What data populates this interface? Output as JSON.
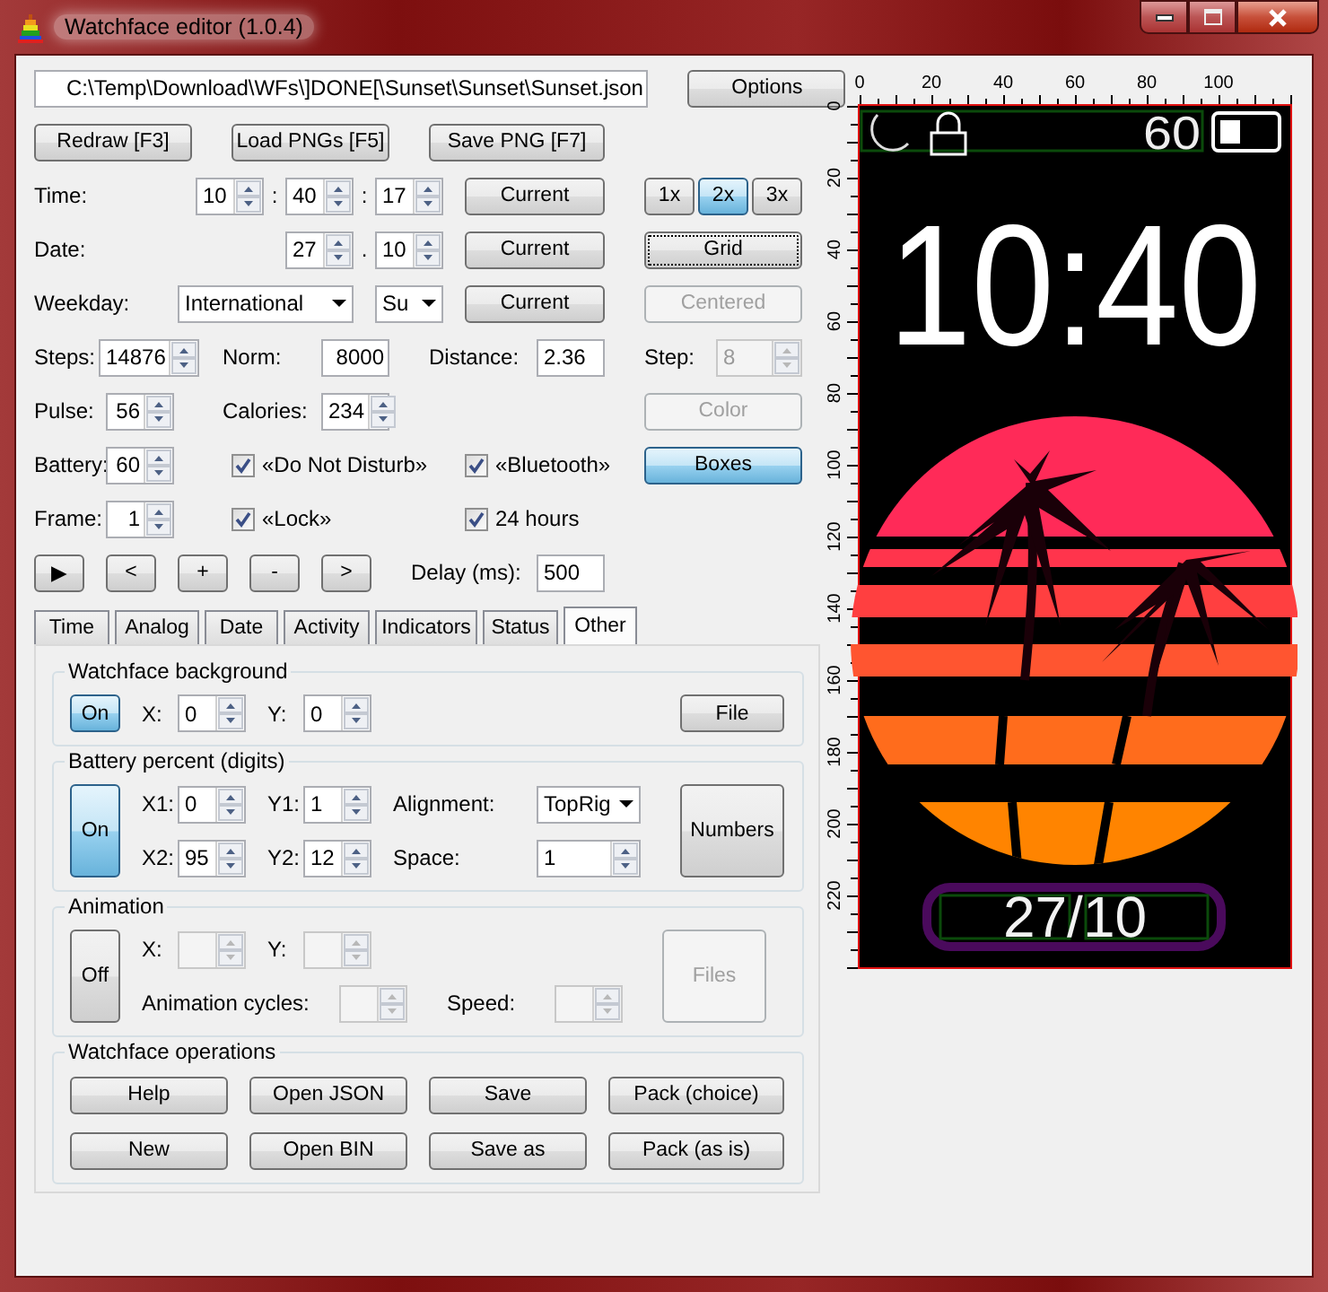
{
  "window": {
    "title": "Watchface editor (1.0.4)"
  },
  "file_path": "C:\\Temp\\Download\\WFs\\]DONE[\\Sunset\\Sunset\\Sunset.json",
  "options_button": "Options",
  "toolbar": [
    "Redraw [F3]",
    "Load PNGs [F5]",
    "Save PNG [F7]"
  ],
  "time": {
    "label": "Time:",
    "hours": {
      "value": "10"
    },
    "separator_1": ":",
    "minutes": {
      "value": "40"
    },
    "separator_2": ":",
    "seconds": {
      "value": "17"
    },
    "current_button": "Current"
  },
  "date": {
    "label": "Date:",
    "day": {
      "value": "27"
    },
    "separator": ".",
    "month": {
      "value": "10"
    },
    "current_button": "Current"
  },
  "weekday": {
    "label": "Weekday:",
    "format": "International",
    "day": "Su",
    "current_button": "Current"
  },
  "scale": [
    {
      "label": "1x",
      "selected": false
    },
    {
      "label": "2x",
      "selected": true
    },
    {
      "label": "3x",
      "selected": false
    }
  ],
  "grid_button": {
    "label": "Grid",
    "focused": true
  },
  "centered_button": {
    "label": "Centered",
    "disabled": true
  },
  "steps": {
    "label": "Steps:",
    "value": "14876"
  },
  "norm": {
    "label": "Norm:",
    "value": "8000"
  },
  "distance": {
    "label": "Distance:",
    "value": "2.36"
  },
  "step": {
    "label": "Step:",
    "value": "8",
    "disabled": true
  },
  "pulse": {
    "label": "Pulse:",
    "value": "56"
  },
  "calories": {
    "label": "Calories:",
    "value": "234"
  },
  "color_button": {
    "label": "Color",
    "disabled": true
  },
  "battery": {
    "label": "Battery:",
    "value": "60"
  },
  "checkboxes": [
    {
      "label": "«Do Not Disturb»",
      "checked": true
    },
    {
      "label": "«Bluetooth»",
      "checked": true
    },
    {
      "label": "«Lock»",
      "checked": true
    },
    {
      "label": "24 hours",
      "checked": true
    }
  ],
  "boxes_button": {
    "label": "Boxes",
    "pressed": true
  },
  "frame": {
    "label": "Frame:",
    "value": "1"
  },
  "playback": [
    "▶",
    "<",
    "+",
    "-",
    ">"
  ],
  "delay": {
    "label": "Delay (ms):",
    "value": "500"
  },
  "tabs": [
    {
      "label": "Time",
      "selected": false
    },
    {
      "label": "Analog",
      "selected": false
    },
    {
      "label": "Date",
      "selected": false
    },
    {
      "label": "Activity",
      "selected": false
    },
    {
      "label": "Indicators",
      "selected": false
    },
    {
      "label": "Status",
      "selected": false
    },
    {
      "label": "Other",
      "selected": true
    }
  ],
  "background_group": {
    "title": "Watchface background",
    "toggle": {
      "label": "On",
      "on": true
    },
    "x": {
      "label": "X:",
      "value": "0"
    },
    "y": {
      "label": "Y:",
      "value": "0"
    },
    "file_button": "File"
  },
  "battery_group": {
    "title": "Battery percent (digits)",
    "toggle": {
      "label": "On",
      "on": true
    },
    "x1": {
      "label": "X1:",
      "value": "0"
    },
    "y1": {
      "label": "Y1:",
      "value": "1"
    },
    "x2": {
      "label": "X2:",
      "value": "95"
    },
    "y2": {
      "label": "Y2:",
      "value": "12"
    },
    "alignment": {
      "label": "Alignment:",
      "value": "TopRig"
    },
    "space": {
      "label": "Space:",
      "value": "1"
    },
    "numbers_button": "Numbers"
  },
  "animation_group": {
    "title": "Animation",
    "toggle": {
      "label": "Off",
      "on": false
    },
    "x": {
      "label": "X:",
      "disabled": true
    },
    "y": {
      "label": "Y:",
      "disabled": true
    },
    "cycles": {
      "label": "Animation cycles:",
      "disabled": true
    },
    "speed": {
      "label": "Speed:",
      "disabled": true
    },
    "files_button": {
      "label": "Files",
      "disabled": true
    }
  },
  "operations_group": {
    "title": "Watchface operations",
    "buttons": [
      [
        "Help",
        "Open JSON",
        "Save",
        "Pack (choice)"
      ],
      [
        "New",
        "Open BIN",
        "Save as",
        "Pack (as is)"
      ]
    ]
  },
  "preview": {
    "x_ruler": [
      "0",
      "20",
      "40",
      "60",
      "80",
      "100"
    ],
    "y_ruler": [
      "0",
      "20",
      "40",
      "60",
      "80",
      "100",
      "120",
      "140",
      "160",
      "180",
      "200",
      "220"
    ],
    "battery_reading": "60",
    "time": "10:40",
    "date": "27/10"
  }
}
